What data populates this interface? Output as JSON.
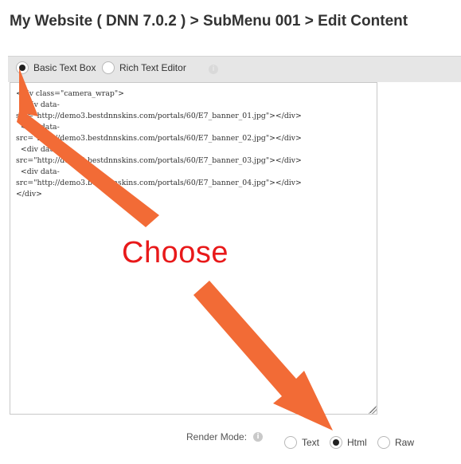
{
  "page": {
    "title": "My Website ( DNN 7.0.2 ) > SubMenu 001 > Edit Content"
  },
  "editor_mode": {
    "options": [
      {
        "label": "Basic Text Box",
        "selected": true
      },
      {
        "label": "Rich Text Editor",
        "selected": false
      }
    ],
    "info_icon": "info-icon"
  },
  "editor": {
    "content": "<div class=\"camera_wrap\">\n  <div data-\nsrc=\"http://demo3.bestdnnskins.com/portals/60/E7_banner_01.jpg\"></div>\n  <div data-\nsrc=\"http://demo3.bestdnnskins.com/portals/60/E7_banner_02.jpg\"></div>\n  <div data-\nsrc=\"http://demo3.bestdnnskins.com/portals/60/E7_banner_03.jpg\"></div>\n  <div data-\nsrc=\"http://demo3.bestdnnskins.com/portals/60/E7_banner_04.jpg\"></div>\n</div>"
  },
  "render_mode": {
    "label": "Render Mode:",
    "info_icon": "info-icon",
    "options": [
      {
        "label": "Text",
        "selected": false
      },
      {
        "label": "Html",
        "selected": true
      },
      {
        "label": "Raw",
        "selected": false
      }
    ]
  },
  "annotation": {
    "text": "Choose",
    "text_color": "#e8191a",
    "arrow_color": "#f26b36"
  },
  "colors": {
    "toolbar_bg": "#e6e6e6",
    "border": "#c8c8c8"
  }
}
